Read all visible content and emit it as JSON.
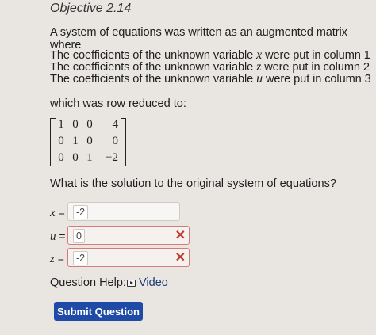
{
  "objective": "Objective 2.14",
  "intro": "A system of equations was written as an augmented matrix where",
  "coefficients": [
    {
      "prefix": "The coefficients of the unknown variable ",
      "variable": "x",
      "suffix": " were put in column 1"
    },
    {
      "prefix": "The coefficients of the unknown variable ",
      "variable": "z",
      "suffix": " were put in column 2"
    },
    {
      "prefix": "The coefficients of the unknown variable ",
      "variable": "u",
      "suffix": " were put in column 3"
    }
  ],
  "reduced_text": "which was row reduced to:",
  "matrix": [
    [
      "1",
      "0",
      "0",
      "4"
    ],
    [
      "0",
      "1",
      "0",
      "0"
    ],
    [
      "0",
      "0",
      "1",
      "−2"
    ]
  ],
  "question": "What is the solution to the original system of equations?",
  "answers": [
    {
      "variable": "x",
      "equals": "=",
      "value": "-2",
      "status": "neutral"
    },
    {
      "variable": "u",
      "equals": "=",
      "value": "0",
      "status": "incorrect"
    },
    {
      "variable": "z",
      "equals": "=",
      "value": "-2",
      "status": "incorrect"
    }
  ],
  "incorrect_mark": "✕",
  "help_label": "Question Help:",
  "video_label": "Video",
  "submit_label": "Submit Question",
  "colors": {
    "background": "#e9e6e2",
    "submit_button": "#1f4ba6",
    "incorrect": "#c0392b",
    "link": "#1c3c78"
  }
}
